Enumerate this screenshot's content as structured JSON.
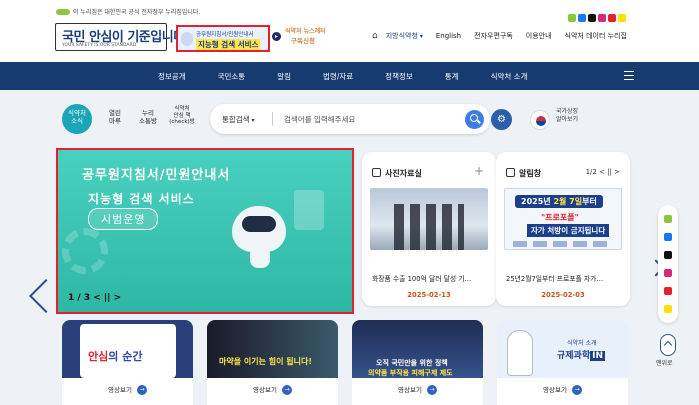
{
  "header": {
    "gov_notice": "이 누리집은 대한민국 공식 전자정부 누리집입니다.",
    "logo_korean": "국민 안심이 기준입니다",
    "logo_english": "YOUR SAFETY IS OUR STANDARD",
    "promo_line1": "공무원지침서/민원안내서",
    "promo_line2": "지능형 검색 서비스",
    "promo2_line1": "식약처 뉴스레터",
    "promo2_line2": "구독신청",
    "util": {
      "language": "지방식약청",
      "english": "English",
      "email": "전자우편구독",
      "guide": "이용안내",
      "data": "식약처 데이터 누리집"
    }
  },
  "nav": {
    "items": [
      "정보공개",
      "국민소통",
      "알림",
      "법령/자료",
      "정책정보",
      "통계",
      "식약처 소개"
    ]
  },
  "quick": {
    "items": [
      {
        "label": "식약처\n소식"
      },
      {
        "label": "열린\n마루"
      },
      {
        "label": "누리\n소통방"
      },
      {
        "label": "식약처\n안심 책\n(check)방"
      }
    ]
  },
  "search": {
    "scope": "통합검색",
    "placeholder": "검색어를 입력해주세요"
  },
  "slogan": {
    "line1": "국가상징",
    "line2": "알아보기"
  },
  "banner": {
    "title1": "공무원지침서/민원안내서",
    "title2": "지능형 검색 서비스",
    "title3": "시범운영",
    "pager": "1 / 3",
    "controls": "< || >"
  },
  "photo_card": {
    "title": "사진자료실",
    "caption": "화장품 수출 100억 달러 달성 기…",
    "date": "2025-02-13"
  },
  "notice_card": {
    "title": "알림창",
    "pager": "1/2",
    "controls": "< || >",
    "banner_l1_prefix": "2025년",
    "banner_l1_hl": "2월 7일",
    "banner_l1_suffix": "부터",
    "banner_l2": "\"프로포폴\"",
    "banner_l3": "자가 처방이 금지됩니다",
    "caption": "25년2월7일부터 프로포폴 자가…",
    "date": "2025-02-03"
  },
  "videos": [
    {
      "line1": "안심",
      "line1_suffix": "의 순간",
      "button": "영상보기"
    },
    {
      "line1": "마약을 이기는 힘이 됩니다!",
      "button": "영상보기"
    },
    {
      "line1": "오직 국민만을 위한 정책",
      "line2": "의약품 부작용 피해구제 제도",
      "button": "영상보기"
    },
    {
      "line1": "규제과학",
      "line1_hl": "IN",
      "line2": "식약처 소개",
      "button": "영상보기"
    }
  ],
  "side": {
    "top_label": "맨위로"
  },
  "colors": {
    "nav_bg": "#153b6f",
    "accent": "#1aa5b8",
    "highlight": "#e4222d",
    "date": "#c8531a"
  }
}
